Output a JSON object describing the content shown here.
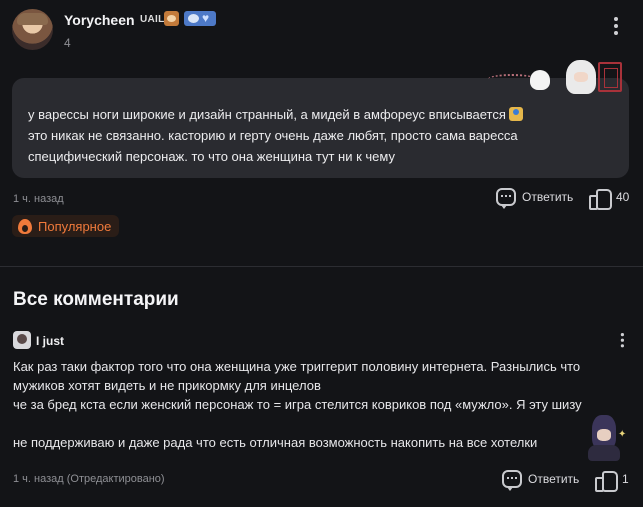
{
  "post": {
    "author": "Yorycheen",
    "badge_text": "UAIL",
    "sub": "4",
    "text_lines": [
      "у варессы ноги широкие и дизайн странный, а мидей в амфореус вписывается",
      "это никак не связанно. касторию и герту очень даже любят, просто сама варесса",
      "специфический персонаж. то что она женщина тут ни к чему"
    ],
    "time": "1 ч. назад",
    "reply_label": "Ответить",
    "likes": "40",
    "tag_label": "Популярное"
  },
  "section_title": "Все комментарии",
  "comment": {
    "author": "I just",
    "text_lines": [
      "Как раз таки фактор того что она женщина уже триггерит половину интернета. Разнылись что",
      "мужиков хотят видеть и не прикормку для инцелов",
      "че за бред кста если женский персонаж то = игра стелится ковриков под «мужло». Я эту шизу",
      "",
      "не поддерживаю и даже рада что есть отличная возможность накопить на все хотелки"
    ],
    "time": "1 ч. назад (Отредактировано)",
    "reply_label": "Ответить",
    "likes": "1"
  },
  "colors": {
    "background": "#131417",
    "bubble": "#2a2b30",
    "accent": "#f07a3b"
  },
  "icons": [
    "more-vertical-icon",
    "reply-icon",
    "thumbs-up-icon",
    "flame-icon"
  ]
}
